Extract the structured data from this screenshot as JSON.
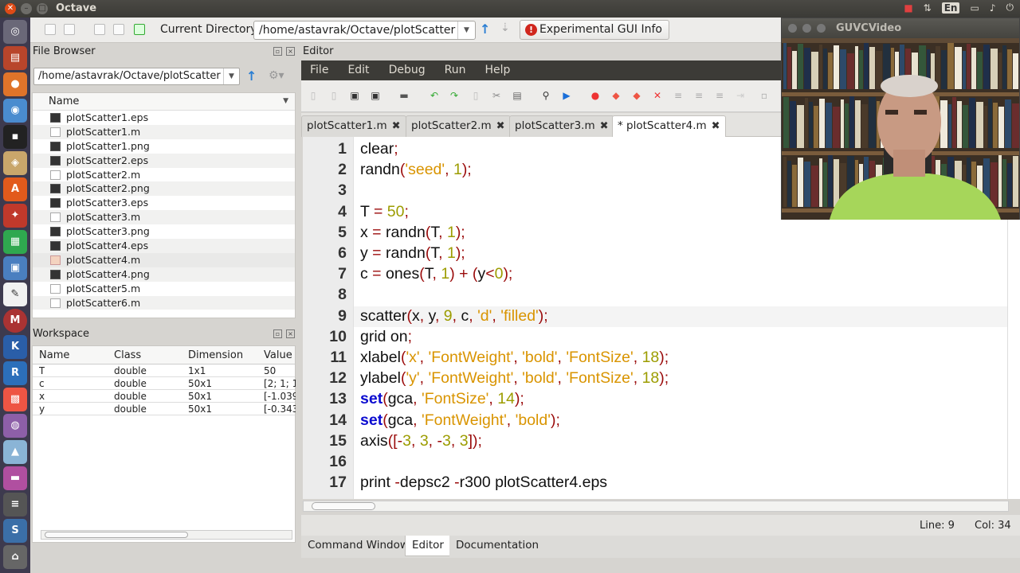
{
  "window": {
    "title": "Octave"
  },
  "tray": {
    "lang": "En"
  },
  "toolbar": {
    "current_directory_label": "Current Directory:",
    "current_directory": "/home/astavrak/Octave/plotScatter",
    "experimental_gui_info": "Experimental GUI Info"
  },
  "file_browser": {
    "title": "File Browser",
    "path": "/home/astavrak/Octave/plotScatter",
    "column_name": "Name",
    "files": [
      {
        "name": "plotScatter1.eps",
        "type": "image"
      },
      {
        "name": "plotScatter1.m",
        "type": "script"
      },
      {
        "name": "plotScatter1.png",
        "type": "image"
      },
      {
        "name": "plotScatter2.eps",
        "type": "image"
      },
      {
        "name": "plotScatter2.m",
        "type": "script"
      },
      {
        "name": "plotScatter2.png",
        "type": "image"
      },
      {
        "name": "plotScatter3.eps",
        "type": "image"
      },
      {
        "name": "plotScatter3.m",
        "type": "script"
      },
      {
        "name": "plotScatter3.png",
        "type": "image"
      },
      {
        "name": "plotScatter4.eps",
        "type": "image"
      },
      {
        "name": "plotScatter4.m",
        "type": "script-open"
      },
      {
        "name": "plotScatter4.png",
        "type": "image"
      },
      {
        "name": "plotScatter5.m",
        "type": "script"
      },
      {
        "name": "plotScatter6.m",
        "type": "script"
      }
    ]
  },
  "workspace": {
    "title": "Workspace",
    "columns": [
      "Name",
      "Class",
      "Dimension",
      "Value"
    ],
    "rows": [
      [
        "T",
        "double",
        "1x1",
        "50"
      ],
      [
        "c",
        "double",
        "50x1",
        "[2; 1; 1"
      ],
      [
        "x",
        "double",
        "50x1",
        "[-1.039"
      ],
      [
        "y",
        "double",
        "50x1",
        "[-0.343"
      ]
    ]
  },
  "editor": {
    "title": "Editor",
    "menu": [
      "File",
      "Edit",
      "Debug",
      "Run",
      "Help"
    ],
    "tabs": [
      {
        "label": "plotScatter1.m",
        "active": false
      },
      {
        "label": "plotScatter2.m",
        "active": false
      },
      {
        "label": "plotScatter3.m",
        "active": false
      },
      {
        "label": "* plotScatter4.m",
        "active": true
      }
    ],
    "lines": [
      [
        [
          "clear",
          "t"
        ],
        [
          ";",
          "p"
        ]
      ],
      [
        [
          "randn",
          "t"
        ],
        [
          "(",
          "p"
        ],
        [
          "'seed'",
          "s"
        ],
        [
          ", ",
          "p"
        ],
        [
          "1",
          "n"
        ],
        [
          ");",
          "p"
        ]
      ],
      [],
      [
        [
          "T ",
          "t"
        ],
        [
          "=",
          "p"
        ],
        [
          " ",
          "t"
        ],
        [
          "50",
          "n"
        ],
        [
          ";",
          "p"
        ]
      ],
      [
        [
          "x ",
          "t"
        ],
        [
          "=",
          "p"
        ],
        [
          " randn",
          "t"
        ],
        [
          "(",
          "p"
        ],
        [
          "T",
          "t"
        ],
        [
          ", ",
          "p"
        ],
        [
          "1",
          "n"
        ],
        [
          ");",
          "p"
        ]
      ],
      [
        [
          "y ",
          "t"
        ],
        [
          "=",
          "p"
        ],
        [
          " randn",
          "t"
        ],
        [
          "(",
          "p"
        ],
        [
          "T",
          "t"
        ],
        [
          ", ",
          "p"
        ],
        [
          "1",
          "n"
        ],
        [
          ");",
          "p"
        ]
      ],
      [
        [
          "c ",
          "t"
        ],
        [
          "=",
          "p"
        ],
        [
          " ones",
          "t"
        ],
        [
          "(",
          "p"
        ],
        [
          "T",
          "t"
        ],
        [
          ", ",
          "p"
        ],
        [
          "1",
          "n"
        ],
        [
          ") + (",
          "p"
        ],
        [
          "y",
          "t"
        ],
        [
          "<",
          "p"
        ],
        [
          "0",
          "n"
        ],
        [
          ");",
          "p"
        ]
      ],
      [],
      [
        [
          "scatter",
          "t"
        ],
        [
          "(",
          "p"
        ],
        [
          "x",
          "t"
        ],
        [
          ", ",
          "p"
        ],
        [
          "y",
          "t"
        ],
        [
          ", ",
          "p"
        ],
        [
          "9",
          "n"
        ],
        [
          ", ",
          "p"
        ],
        [
          "c",
          "t"
        ],
        [
          ", ",
          "p"
        ],
        [
          "'d'",
          "s"
        ],
        [
          ", ",
          "p"
        ],
        [
          "'filled'",
          "s"
        ],
        [
          ");",
          "p"
        ]
      ],
      [
        [
          "grid on",
          "t"
        ],
        [
          ";",
          "p"
        ]
      ],
      [
        [
          "xlabel",
          "t"
        ],
        [
          "(",
          "p"
        ],
        [
          "'x'",
          "s"
        ],
        [
          ", ",
          "p"
        ],
        [
          "'FontWeight'",
          "s"
        ],
        [
          ", ",
          "p"
        ],
        [
          "'bold'",
          "s"
        ],
        [
          ", ",
          "p"
        ],
        [
          "'FontSize'",
          "s"
        ],
        [
          ", ",
          "p"
        ],
        [
          "18",
          "n"
        ],
        [
          ");",
          "p"
        ]
      ],
      [
        [
          "ylabel",
          "t"
        ],
        [
          "(",
          "p"
        ],
        [
          "'y'",
          "s"
        ],
        [
          ", ",
          "p"
        ],
        [
          "'FontWeight'",
          "s"
        ],
        [
          ", ",
          "p"
        ],
        [
          "'bold'",
          "s"
        ],
        [
          ", ",
          "p"
        ],
        [
          "'FontSize'",
          "s"
        ],
        [
          ", ",
          "p"
        ],
        [
          "18",
          "n"
        ],
        [
          ");",
          "p"
        ]
      ],
      [
        [
          "set",
          "k"
        ],
        [
          "(",
          "p"
        ],
        [
          "gca",
          "t"
        ],
        [
          ", ",
          "p"
        ],
        [
          "'FontSize'",
          "s"
        ],
        [
          ", ",
          "p"
        ],
        [
          "14",
          "n"
        ],
        [
          ");",
          "p"
        ]
      ],
      [
        [
          "set",
          "k"
        ],
        [
          "(",
          "p"
        ],
        [
          "gca",
          "t"
        ],
        [
          ", ",
          "p"
        ],
        [
          "'FontWeight'",
          "s"
        ],
        [
          ", ",
          "p"
        ],
        [
          "'bold'",
          "s"
        ],
        [
          ");",
          "p"
        ]
      ],
      [
        [
          "axis",
          "t"
        ],
        [
          "([",
          "p"
        ],
        [
          "-",
          "p"
        ],
        [
          "3",
          "n"
        ],
        [
          ", ",
          "p"
        ],
        [
          "3",
          "n"
        ],
        [
          ", ",
          "p"
        ],
        [
          "-",
          "p"
        ],
        [
          "3",
          "n"
        ],
        [
          ", ",
          "p"
        ],
        [
          "3",
          "n"
        ],
        [
          "]);",
          "p"
        ]
      ],
      [],
      [
        [
          "print ",
          "t"
        ],
        [
          "-",
          "p"
        ],
        [
          "depsc2 ",
          "t"
        ],
        [
          "-",
          "p"
        ],
        [
          "r300 plotScatter4.eps",
          "t"
        ]
      ]
    ],
    "current_line": 9,
    "status": {
      "line": "Line: 9",
      "col": "Col: 34"
    }
  },
  "bottom_tabs": [
    "Command Window",
    "Editor",
    "Documentation"
  ],
  "video": {
    "title": "GUVCVideo"
  }
}
